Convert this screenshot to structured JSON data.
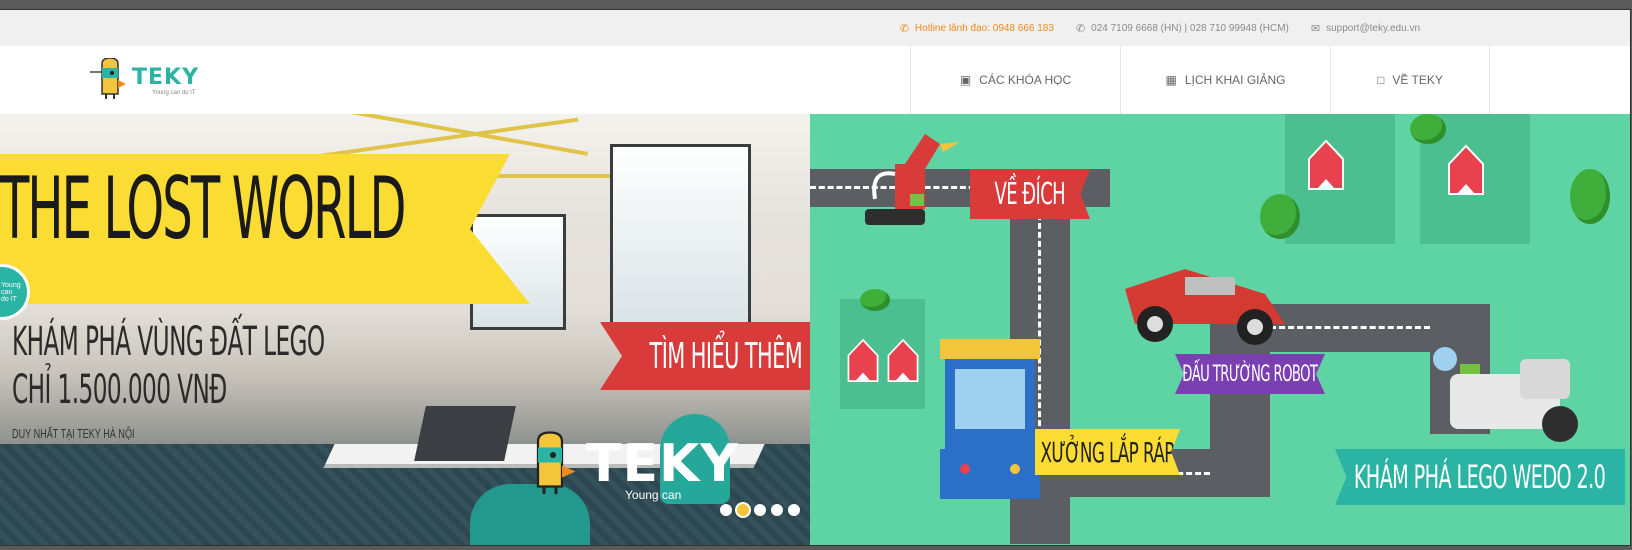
{
  "topbar": {
    "hotline": "Hotline lãnh đạo: 0948 666 183",
    "phones": "024 7109 6668 (HN) | 028 710 99948 (HCM)",
    "email": "support@teky.edu.vn"
  },
  "nav": {
    "logo_text": "TEKY",
    "logo_tagline": "Young can do IT",
    "menu": [
      {
        "label": "CÁC KHÓA HỌC",
        "icon": "book-icon"
      },
      {
        "label": "LỊCH KHAI GIẢNG",
        "icon": "calendar-icon"
      },
      {
        "label": "VỀ TEKY",
        "icon": "document-icon"
      }
    ]
  },
  "hero_left": {
    "title": "THE LOST WORLD",
    "subtitle_line1": "KHÁM PHÁ VÙNG ĐẤT LEGO",
    "subtitle_line2": "CHỈ 1.500.000 VNĐ",
    "subtitle_line3": "DUY NHẤT TẠI TEKY HÀ NỘI",
    "cta": "TÌM HIỂU THÊM",
    "badge": "Young can do IT",
    "brand": "TEKY",
    "brand_tag": "Young can",
    "slides_total": 5,
    "slide_active": 2
  },
  "hero_right": {
    "finish_label": "VỀ ĐÍCH",
    "arena_label": "ĐẤU TRƯỜNG ROBOT",
    "workshop_label": "XƯỞNG LẮP RÁP",
    "explore_label": "KHÁM PHÁ LEGO WEDO 2.0"
  },
  "colors": {
    "accent_teal": "#2bb3a3",
    "banner_yellow": "#fbdc32",
    "cta_red": "#d93a3a",
    "map_green": "#5ed3a4",
    "hotline_orange": "#f08a1c"
  }
}
